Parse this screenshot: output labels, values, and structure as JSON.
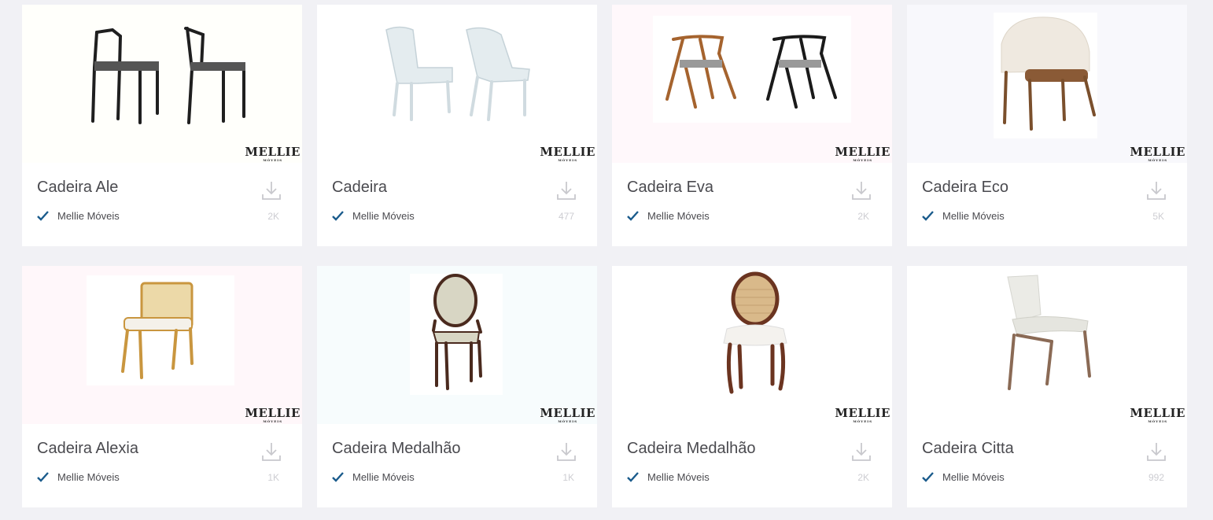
{
  "brand": {
    "name": "MELLIE",
    "sub": "MÓVEIS"
  },
  "cards": [
    {
      "title": "Cadeira Ale",
      "author": "Mellie Móveis",
      "count": "2K",
      "bg": "#fffffb",
      "chair": "ale"
    },
    {
      "title": "Cadeira",
      "author": "Mellie Móveis",
      "count": "477",
      "bg": "#ffffff",
      "chair": "white"
    },
    {
      "title": "Cadeira Eva",
      "author": "Mellie Móveis",
      "count": "2K",
      "bg": "#fff8fb",
      "chair": "eva"
    },
    {
      "title": "Cadeira Eco",
      "author": "Mellie Móveis",
      "count": "5K",
      "bg": "#f8f8fc",
      "chair": "eco"
    },
    {
      "title": "Cadeira Alexia",
      "author": "Mellie Móveis",
      "count": "1K",
      "bg": "#fff7fa",
      "chair": "alexia"
    },
    {
      "title": "Cadeira Medalhão",
      "author": "Mellie Móveis",
      "count": "1K",
      "bg": "#f7fcfd",
      "chair": "medalhao1"
    },
    {
      "title": "Cadeira Medalhão",
      "author": "Mellie Móveis",
      "count": "2K",
      "bg": "#ffffff",
      "chair": "medalhao2"
    },
    {
      "title": "Cadeira Citta",
      "author": "Mellie Móveis",
      "count": "992",
      "bg": "#ffffff",
      "chair": "citta"
    }
  ],
  "colors": {
    "check": "#1a5b8c",
    "title": "#4a4a4f",
    "count": "#cdcdd2",
    "icon": "#c8c8cd"
  },
  "icons": {
    "download": "download-icon",
    "verified": "check-icon"
  }
}
